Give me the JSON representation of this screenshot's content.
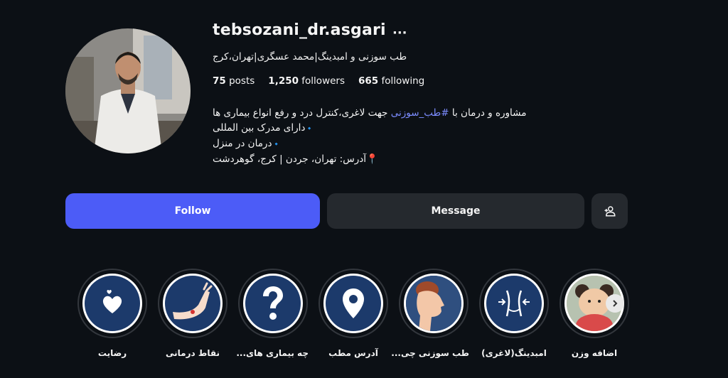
{
  "profile": {
    "username": "tebsozani_dr.asgari",
    "more_label": "···",
    "full_name": "طب سوزنی و امبدینگ|محمد عسگری|تهران،کرج",
    "stats": {
      "posts_count": "75",
      "posts_label": "posts",
      "followers_count": "1,250",
      "followers_label": "followers",
      "following_count": "665",
      "following_label": "following"
    },
    "bio": {
      "line1_pre": "مشاوره و درمان با ",
      "line1_hashtag": "#طب_سوزنی",
      "line1_post": " جهت لاغری،کنترل درد و رفع انواع بیماری ها",
      "line2": "دارای مدرک بین المللی",
      "line3": "درمان در منزل",
      "line4": "آدرس: تهران، جردن | کرج، گوهردشت",
      "diamond": "🔹",
      "pin": "📍"
    }
  },
  "actions": {
    "follow_label": "Follow",
    "message_label": "Message",
    "add_user_icon": "person-add-icon"
  },
  "highlights": [
    {
      "label": "رضایت",
      "icon": "heart-hands-icon"
    },
    {
      "label": "نقاط درمانی",
      "icon": "arm-icon"
    },
    {
      "label": "چه بیماری های...",
      "icon": "question-icon"
    },
    {
      "label": "آدرس مطب",
      "icon": "location-pin-icon"
    },
    {
      "label": "طب سوزنی چی...",
      "icon": "face-profile-icon"
    },
    {
      "label": "امبدینگ(لاغری)",
      "icon": "waist-icon"
    },
    {
      "label": "اضافه وزن",
      "icon": "child-photo"
    }
  ],
  "colors": {
    "background": "#0c1015",
    "follow": "#4c5cf7",
    "secondary_button": "#25292e",
    "hashtag": "#7c8cff",
    "highlight_fill": "#1c3a6b"
  }
}
